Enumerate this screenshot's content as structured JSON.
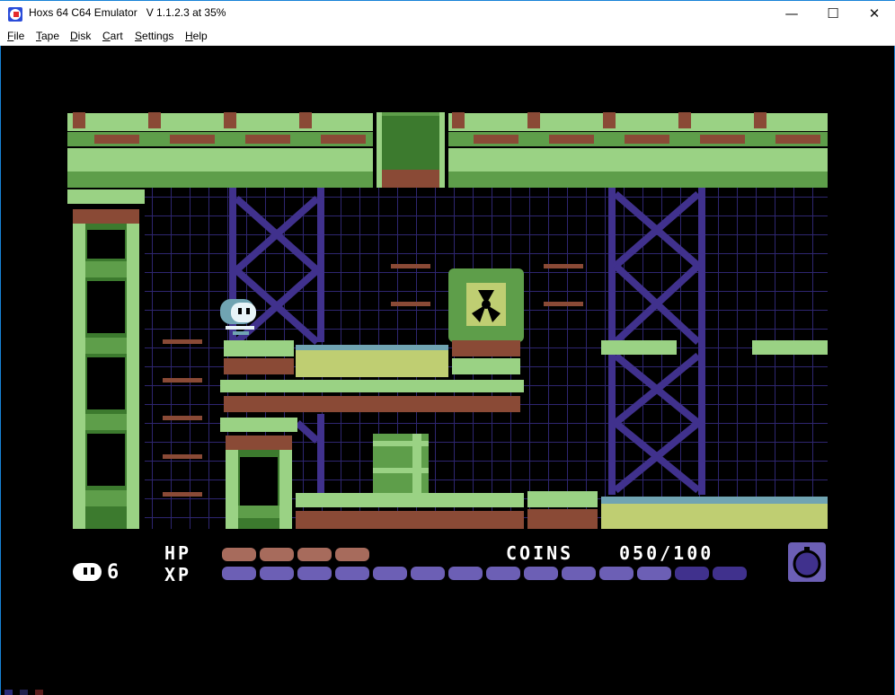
{
  "window": {
    "title": "Hoxs 64 C64 Emulator   V 1.1.2.3 at 35%",
    "minimize_glyph": "—",
    "maximize_glyph": "☐",
    "close_glyph": "✕"
  },
  "menu": {
    "items": [
      {
        "key": "F",
        "rest": "ile"
      },
      {
        "key": "T",
        "rest": "ape"
      },
      {
        "key": "D",
        "rest": "isk"
      },
      {
        "key": "C",
        "rest": "art"
      },
      {
        "key": "S",
        "rest": "ettings"
      },
      {
        "key": "H",
        "rest": "elp"
      }
    ]
  },
  "hud": {
    "lives": "6",
    "hp_label": "HP",
    "xp_label": "XP",
    "coins_label": "COINS",
    "coins_value": "050/100",
    "hp_filled": 4,
    "hp_total": 4,
    "xp_filled": 12,
    "xp_total": 14
  },
  "colors": {
    "green_light": "#9ad284",
    "green_mid": "#5e9e4a",
    "green_dark": "#3c7a2e",
    "brown": "#8a4a36",
    "purple": "#40318d",
    "purple_light": "#7869c4",
    "yellow": "#bfce72",
    "cyan": "#70a4b2",
    "hp_color": "#a76b5c",
    "xp_color": "#6c5fb5",
    "xp_empty": "#40318d"
  }
}
